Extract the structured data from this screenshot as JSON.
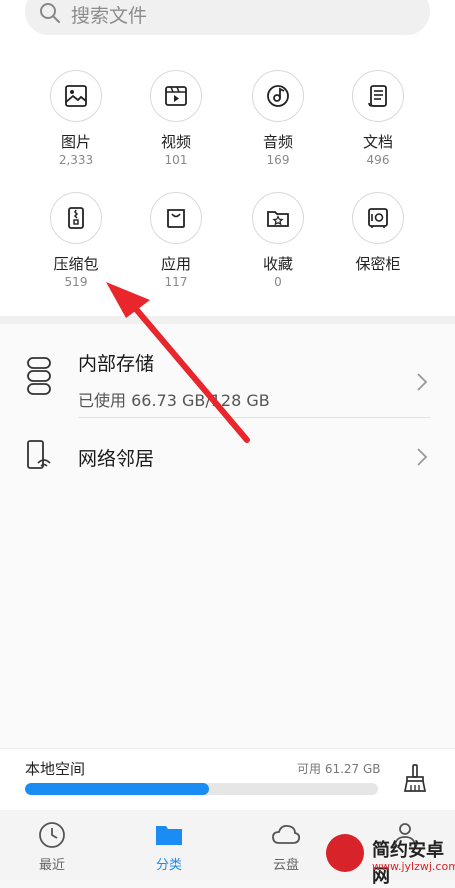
{
  "search": {
    "placeholder": "搜索文件"
  },
  "categories": [
    {
      "label": "图片",
      "count": "2,333",
      "icon": "image-icon"
    },
    {
      "label": "视频",
      "count": "101",
      "icon": "video-icon"
    },
    {
      "label": "音频",
      "count": "169",
      "icon": "audio-icon"
    },
    {
      "label": "文档",
      "count": "496",
      "icon": "document-icon"
    },
    {
      "label": "压缩包",
      "count": "519",
      "icon": "zip-icon"
    },
    {
      "label": "应用",
      "count": "117",
      "icon": "app-bag-icon"
    },
    {
      "label": "收藏",
      "count": "0",
      "icon": "star-folder-icon"
    },
    {
      "label": "保密柜",
      "count": "",
      "icon": "safe-icon"
    }
  ],
  "storage": {
    "internal": {
      "title": "内部存储",
      "usage": "已使用 66.73 GB/128 GB"
    },
    "network": {
      "title": "网络邻居"
    }
  },
  "local_space": {
    "label": "本地空间",
    "available": "可用 61.27 GB",
    "used_fraction": 0.52
  },
  "nav": {
    "tabs": [
      {
        "label": "最近",
        "icon": "clock-icon",
        "active": false
      },
      {
        "label": "分类",
        "icon": "folder-icon",
        "active": true
      },
      {
        "label": "云盘",
        "icon": "cloud-icon",
        "active": false
      }
    ]
  },
  "watermark": {
    "name": "简约安卓网",
    "url": "www.jylzwj.com"
  },
  "colors": {
    "accent": "#1a8cf3",
    "annotation_arrow": "#e8262b"
  }
}
